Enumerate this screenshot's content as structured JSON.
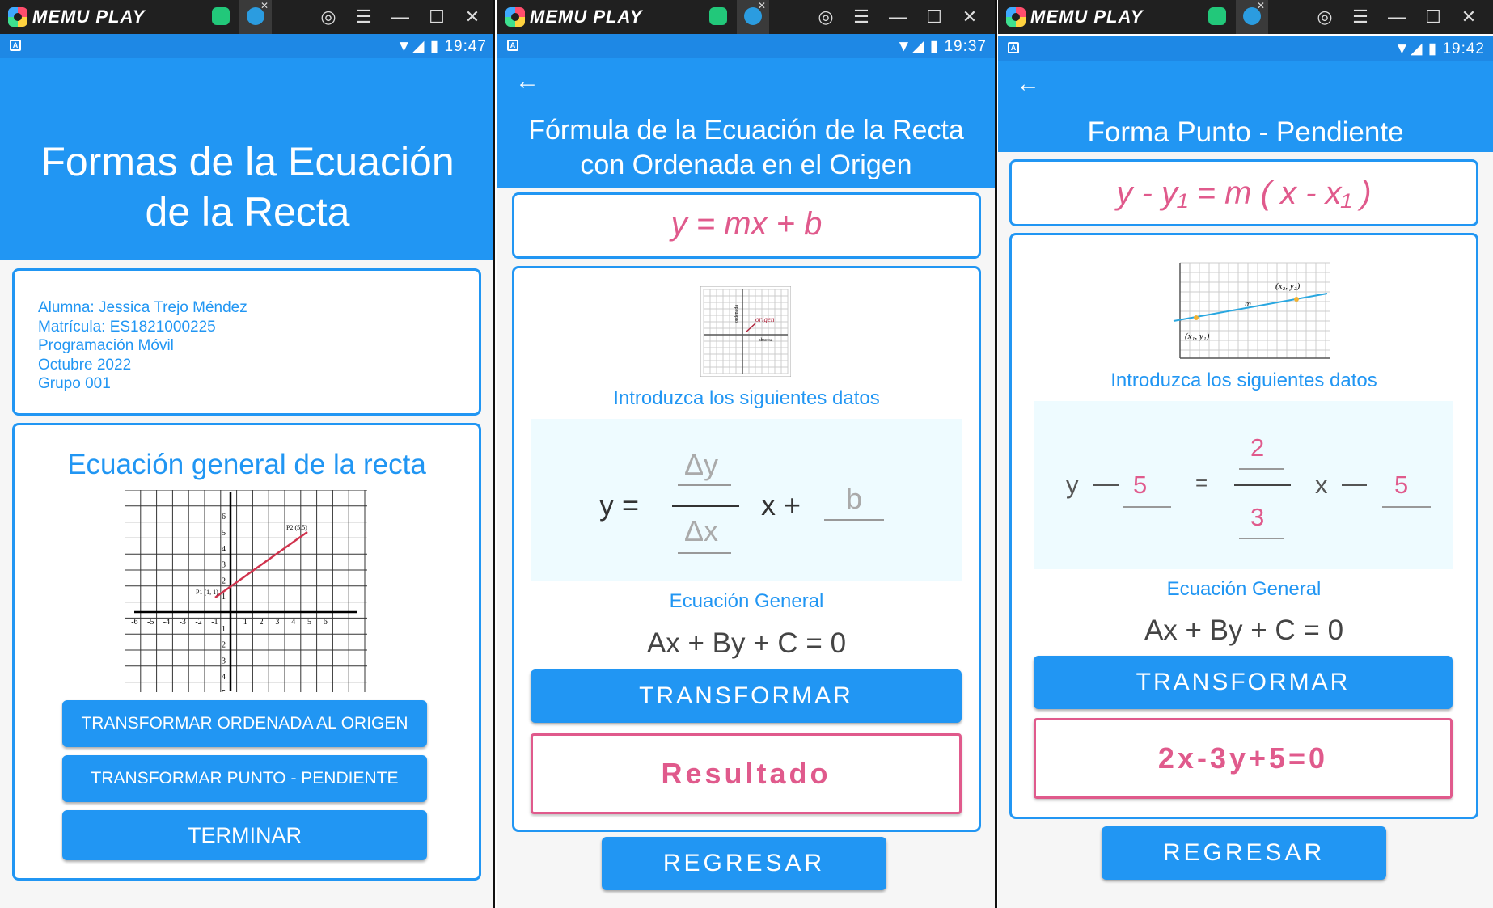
{
  "emulator": {
    "brand": "MEMU PLAY"
  },
  "screen1": {
    "time": "19:47",
    "title_line1": "Formas de la Ecuación",
    "title_line2": "de la Recta",
    "info": [
      "Alumna: Jessica Trejo Méndez",
      "Matrícula: ES1821000225",
      "Programación Móvil",
      "Octubre 2022",
      "Grupo 001"
    ],
    "section_title": "Ecuación general de la recta",
    "graph": {
      "p1": "P1 (1, 1)",
      "p2": "P2 (5,5)",
      "x_ticks": [
        "-6",
        "-5",
        "-4",
        "-3",
        "-2",
        "-1",
        "1",
        "2",
        "3",
        "4",
        "5",
        "6"
      ],
      "y_ticks": [
        "6",
        "5",
        "4",
        "3",
        "2",
        "1",
        "1",
        "2",
        "3",
        "4",
        "5"
      ]
    },
    "btn_ordenada": "TRANSFORMAR ORDENADA AL ORIGEN",
    "btn_punto": "TRANSFORMAR PUNTO - PENDIENTE",
    "btn_terminar": "TERMINAR"
  },
  "screen2": {
    "time": "19:37",
    "title_line1": "Fórmula de la Ecuación de la Recta",
    "title_line2": "con Ordenada en el Origen",
    "formula": "y = mx + b",
    "image_labels": {
      "origen": "origen",
      "abscisa": "abscisa",
      "ordenada": "ordenada"
    },
    "prompt": "Introduzca los siguientes datos",
    "eq": {
      "y": "y =",
      "dy": "Δy",
      "dx": "Δx",
      "xplus": "x +",
      "b": "b"
    },
    "general_label": "Ecuación General",
    "general_eq": "Ax + By + C = 0",
    "btn_transformar": "TRANSFORMAR",
    "result": "Resultado",
    "btn_regresar": "REGRESAR"
  },
  "screen3": {
    "time": "19:42",
    "title": "Forma Punto - Pendiente",
    "formula": "y - y₁ = m ( x - x₁ )",
    "image_labels": {
      "p2": "(x₂, y₂)",
      "p1": "(x₁, y₁)",
      "m": "m"
    },
    "prompt": "Introduzca los siguientes datos",
    "eq": {
      "y": "y",
      "minus1": "—",
      "y1": "5",
      "equals": "=",
      "num": "2",
      "den": "3",
      "x": "x",
      "minus2": "—",
      "x1": "5"
    },
    "general_label": "Ecuación General",
    "general_eq": "Ax + By + C = 0",
    "btn_transformar": "TRANSFORMAR",
    "result": "2x-3y+5=0",
    "btn_regresar": "REGRESAR"
  },
  "colors": {
    "primary": "#2196f3",
    "accent_pink": "#e05a8c",
    "emulator_bar": "#202020"
  }
}
